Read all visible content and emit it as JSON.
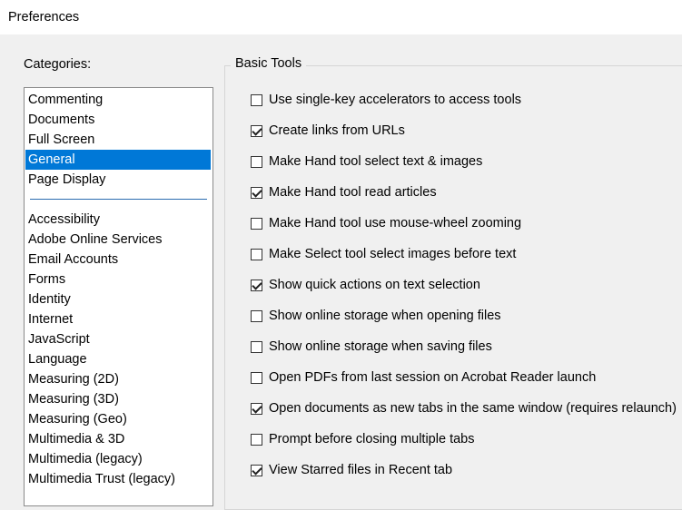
{
  "window": {
    "title": "Preferences"
  },
  "categories": {
    "label": "Categories:",
    "items": [
      "Commenting",
      "Documents",
      "Full Screen",
      "General",
      "Page Display",
      "Accessibility",
      "Adobe Online Services",
      "Email Accounts",
      "Forms",
      "Identity",
      "Internet",
      "JavaScript",
      "Language",
      "Measuring (2D)",
      "Measuring (3D)",
      "Measuring (Geo)",
      "Multimedia & 3D",
      "Multimedia (legacy)",
      "Multimedia Trust (legacy)"
    ],
    "selected": "General"
  },
  "basic_tools": {
    "label": "Basic Tools",
    "options": [
      {
        "label": "Use single-key accelerators to access tools",
        "checked": false
      },
      {
        "label": "Create links from URLs",
        "checked": true
      },
      {
        "label": "Make Hand tool select text & images",
        "checked": false
      },
      {
        "label": "Make Hand tool read articles",
        "checked": true
      },
      {
        "label": "Make Hand tool use mouse-wheel zooming",
        "checked": false
      },
      {
        "label": "Make Select tool select images before text",
        "checked": false
      },
      {
        "label": "Show quick actions on text selection",
        "checked": true
      },
      {
        "label": "Show online storage when opening files",
        "checked": false
      },
      {
        "label": "Show online storage when saving files",
        "checked": false
      },
      {
        "label": "Open PDFs from last session on Acrobat Reader launch",
        "checked": false
      },
      {
        "label": "Open documents as new tabs in the same window (requires relaunch)",
        "checked": true
      },
      {
        "label": "Prompt before closing multiple tabs",
        "checked": false
      },
      {
        "label": "View Starred files in Recent tab",
        "checked": true
      }
    ]
  }
}
